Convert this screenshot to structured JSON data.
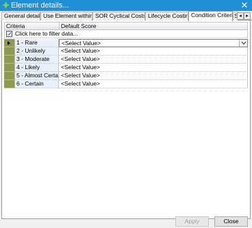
{
  "window": {
    "title": "Element details...",
    "close_glyph": "✕"
  },
  "tabs": [
    {
      "label": "General details",
      "active": false
    },
    {
      "label": "Use Element within ..",
      "active": false
    },
    {
      "label": "SOR Cyclical Costs",
      "active": false
    },
    {
      "label": "Lifecycle Costing",
      "active": false
    },
    {
      "label": "Condition Criteria",
      "active": true
    },
    {
      "label": "S",
      "active": false
    }
  ],
  "tab_scroll": {
    "left": "◂",
    "right": "▸"
  },
  "grid": {
    "columns": [
      "Criteria",
      "Default Score"
    ],
    "filter_text": "Click here to filter data...",
    "rows": [
      {
        "criteria": "1 - Rare",
        "score": "<Select Value>",
        "selected": true
      },
      {
        "criteria": "2 - Unlikely",
        "score": "<Select Value>",
        "selected": false
      },
      {
        "criteria": "3 - Moderate",
        "score": "<Select Value>",
        "selected": false
      },
      {
        "criteria": "4 - Likely",
        "score": "<Select Value>",
        "selected": false
      },
      {
        "criteria": "5 - Almost Certain",
        "score": "<Select Value>",
        "selected": false
      },
      {
        "criteria": "6 - Certain",
        "score": "<Select Value>",
        "selected": false
      }
    ]
  },
  "buttons": {
    "apply": "Apply",
    "close": "Close"
  },
  "colors": {
    "titlebar": "#1f8fd6",
    "row_indicator": "#8f9a4f",
    "criteria_cell": "#e8f1fb"
  }
}
